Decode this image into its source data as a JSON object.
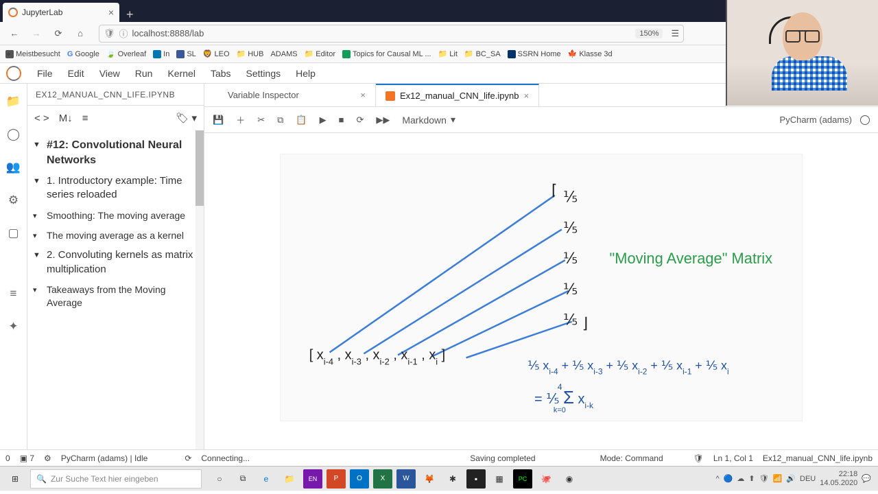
{
  "browser": {
    "tab_title": "JupyterLab",
    "url": "localhost:8888/lab",
    "zoom": "150%"
  },
  "bookmarks": [
    "Meistbesucht",
    "Google",
    "Overleaf",
    "In",
    "SL",
    "LEO",
    "HUB",
    "ADAMS",
    "Editor",
    "Topics for Causal ML ...",
    "Lit",
    "BC_SA",
    "SSRN Home",
    "Klasse 3d"
  ],
  "menu": [
    "File",
    "Edit",
    "View",
    "Run",
    "Kernel",
    "Tabs",
    "Settings",
    "Help"
  ],
  "left_tab": "EX12_MANUAL_CNN_LIFE.IPYNB",
  "toc": [
    {
      "level": 1,
      "text": "#12: Convolutional Neural Networks"
    },
    {
      "level": 2,
      "text": "1. Introductory example: Time series reloaded"
    },
    {
      "level": 3,
      "text": "Smoothing: The moving average"
    },
    {
      "level": 3,
      "text": "The moving average as a kernel"
    },
    {
      "level": 2,
      "text": "2. Convoluting kernels as matrix multiplication"
    },
    {
      "level": 3,
      "text": "Takeaways from the Moving Average"
    }
  ],
  "doc_tabs": [
    {
      "label": "Variable Inspector",
      "active": false
    },
    {
      "label": "Ex12_manual_CNN_life.ipynb",
      "active": true
    }
  ],
  "cell_type": "Markdown",
  "kernel_name": "PyCharm (adams)",
  "status": {
    "left_num": "0",
    "term": "7",
    "pycharm": "PyCharm (adams) | Idle",
    "connecting": "Connecting...",
    "saving": "Saving completed",
    "mode": "Mode: Command",
    "ln": "Ln 1, Col 1",
    "file": "Ex12_manual_CNN_life.ipynb"
  },
  "taskbar": {
    "search_placeholder": "Zur Suche Text hier eingeben",
    "lang": "DEU",
    "time": "22:18",
    "date": "14.05.2020"
  },
  "diagram": {
    "vector_label": "[ xᵢ₋₄ , xᵢ₋₃ , xᵢ₋₂ , xᵢ₋₁ , xᵢ ]",
    "matrix_vals": "⅕",
    "title": "\"Moving Average\" Matrix",
    "eq1": "⅕ xᵢ₋₄ + ⅕ xᵢ₋₃ + ⅕ xᵢ₋₂ + ⅕ xᵢ₋₁ + ⅕ xᵢ",
    "eq2": "= ⅕ Σ xᵢ₋ₖ",
    "eq2_limits": "k=0..4"
  }
}
